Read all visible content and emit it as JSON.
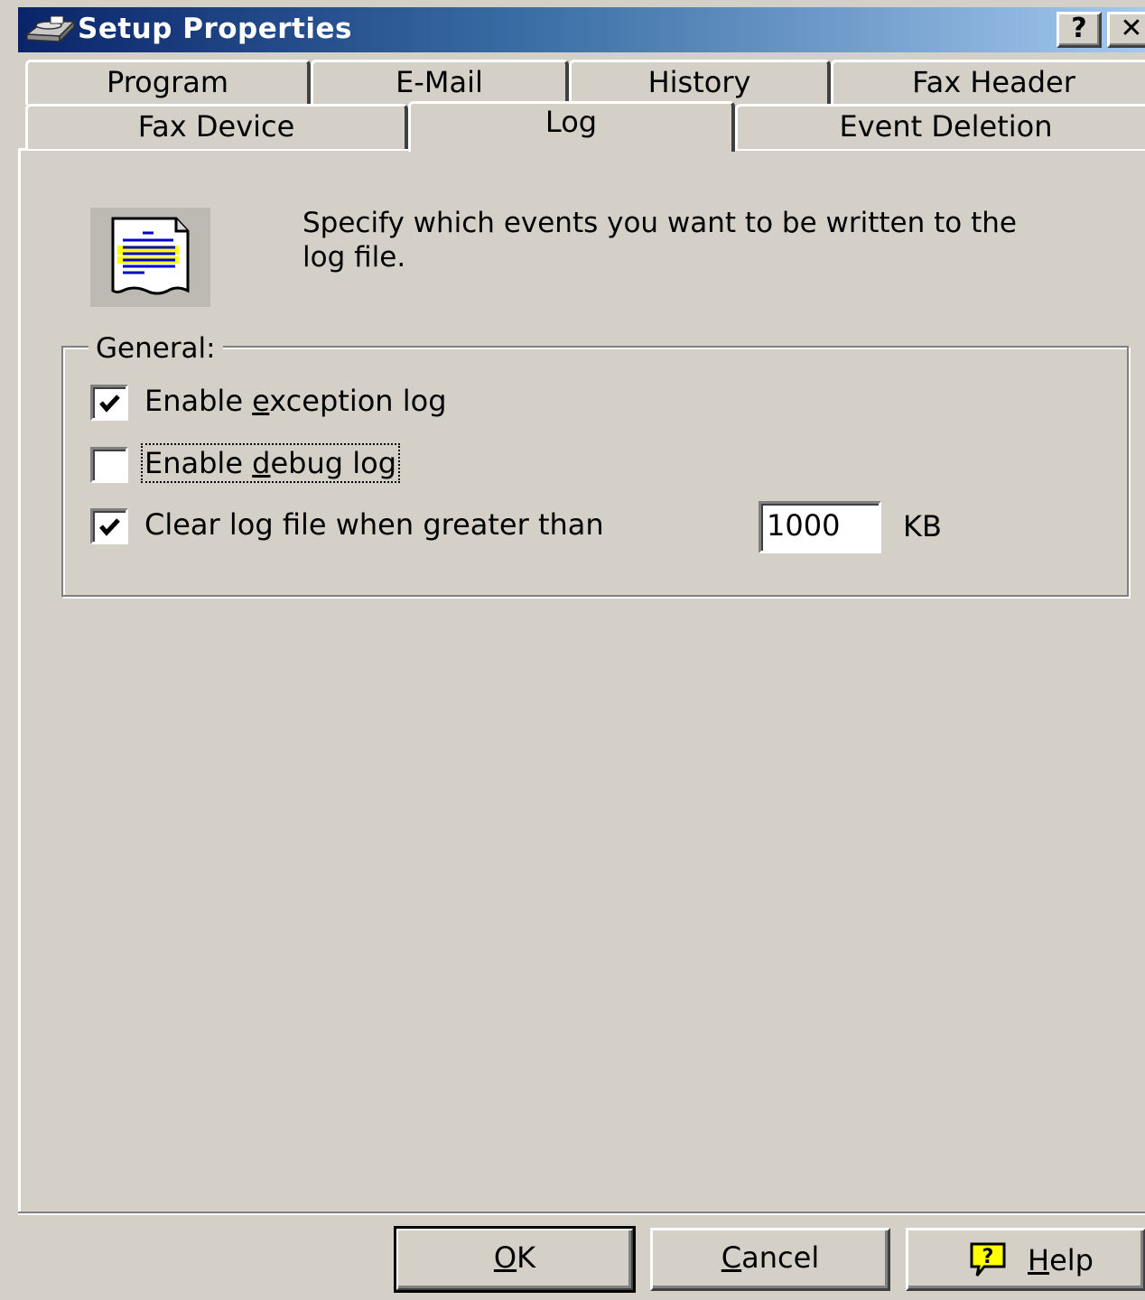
{
  "window": {
    "title": "Setup Properties",
    "help_button": "?",
    "close_button": "✕"
  },
  "tabs": {
    "row1": [
      "Program",
      "E-Mail",
      "History",
      "Fax Header"
    ],
    "row2": [
      "Fax Device",
      "Log",
      "Event Deletion"
    ],
    "active": "Log"
  },
  "log_page": {
    "icon": "log-document-icon",
    "description": "Specify which events you want to be written to the log file.",
    "group_label": "General:",
    "options": [
      {
        "label_pre": "Enable ",
        "label_key": "e",
        "label_post": "xception log",
        "checked": true
      },
      {
        "label_pre": "Enable ",
        "label_key": "d",
        "label_post": "ebug log",
        "checked": false
      },
      {
        "label_pre": "Clear log file when greater than",
        "label_key": "",
        "label_post": "",
        "checked": true
      }
    ],
    "size_value": "1000",
    "size_unit": "KB"
  },
  "buttons": {
    "ok_key": "O",
    "ok_rest": "K",
    "cancel_key": "C",
    "cancel_rest": "ancel",
    "help_key": "H",
    "help_rest": "elp",
    "help_icon": "help-balloon-icon"
  },
  "colors": {
    "titlebar_start": "#0a246a",
    "titlebar_end": "#a6caf0",
    "face": "#d4d0c8"
  }
}
